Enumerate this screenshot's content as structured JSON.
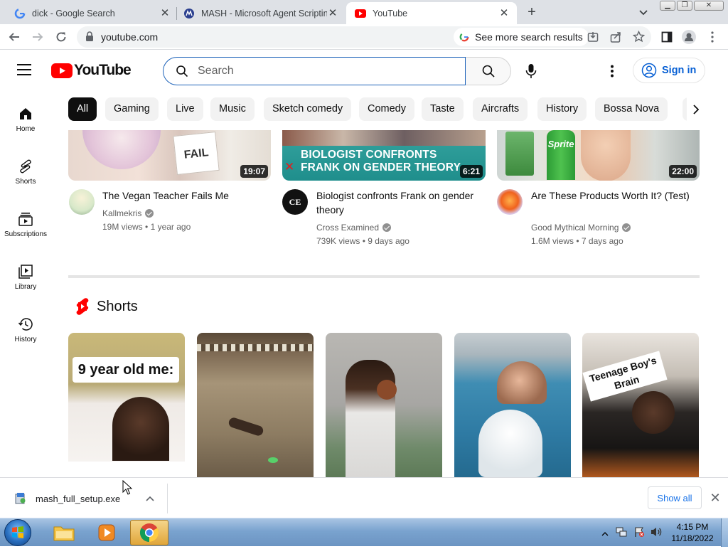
{
  "browser": {
    "tabs": [
      {
        "title": "dick - Google Search",
        "favicon": "google-g-icon",
        "active": false
      },
      {
        "title": "MASH - Microsoft Agent Scripting",
        "favicon": "mash-icon",
        "active": false
      },
      {
        "title": "YouTube",
        "favicon": "youtube-icon",
        "active": true
      }
    ],
    "url": "youtube.com",
    "see_more_label": "See more search results"
  },
  "masthead": {
    "logo_text": "YouTube",
    "search_placeholder": "Search",
    "signin_label": "Sign in"
  },
  "chips": [
    "All",
    "Gaming",
    "Live",
    "Music",
    "Sketch comedy",
    "Comedy",
    "Taste",
    "Aircrafts",
    "History",
    "Bossa Nova"
  ],
  "guide": [
    {
      "label": "Home",
      "icon": "home-icon"
    },
    {
      "label": "Shorts",
      "icon": "shorts-icon"
    },
    {
      "label": "Subscriptions",
      "icon": "subscriptions-icon"
    },
    {
      "label": "Library",
      "icon": "library-icon"
    },
    {
      "label": "History",
      "icon": "history-icon"
    }
  ],
  "videos": [
    {
      "title": "The Vegan Teacher Fails Me",
      "channel": "Kallmekris",
      "views": "19M views",
      "age": "1 year ago",
      "duration": "19:07",
      "overlay": "FAIL"
    },
    {
      "title": "Biologist confronts Frank on gender theory",
      "channel": "Cross Examined",
      "views": "739K views",
      "age": "9 days ago",
      "duration": "6:21",
      "overlay": "BIOLOGIST CONFRONTS FRANK ON GENDER THEORY"
    },
    {
      "title": "Are These Products Worth It? (Test)",
      "channel": "Good Mythical Morning",
      "views": "1.6M views",
      "age": "7 days ago",
      "duration": "22:00",
      "overlay": "Sprite"
    }
  ],
  "shorts": {
    "heading": "Shorts",
    "items": [
      {
        "caption": "9 year old me:"
      },
      {
        "caption": ""
      },
      {
        "caption": ""
      },
      {
        "caption": ""
      },
      {
        "caption": "Teenage Boy's Brain"
      }
    ]
  },
  "download": {
    "filename": "mash_full_setup.exe",
    "show_all_label": "Show all"
  },
  "taskbar": {
    "time": "4:15 PM",
    "date": "11/18/2022"
  },
  "colors": {
    "youtube_red": "#ff0000",
    "link_blue": "#065fd4",
    "chip_bg": "#f2f2f2",
    "chip_selected": "#0f0f0f"
  }
}
